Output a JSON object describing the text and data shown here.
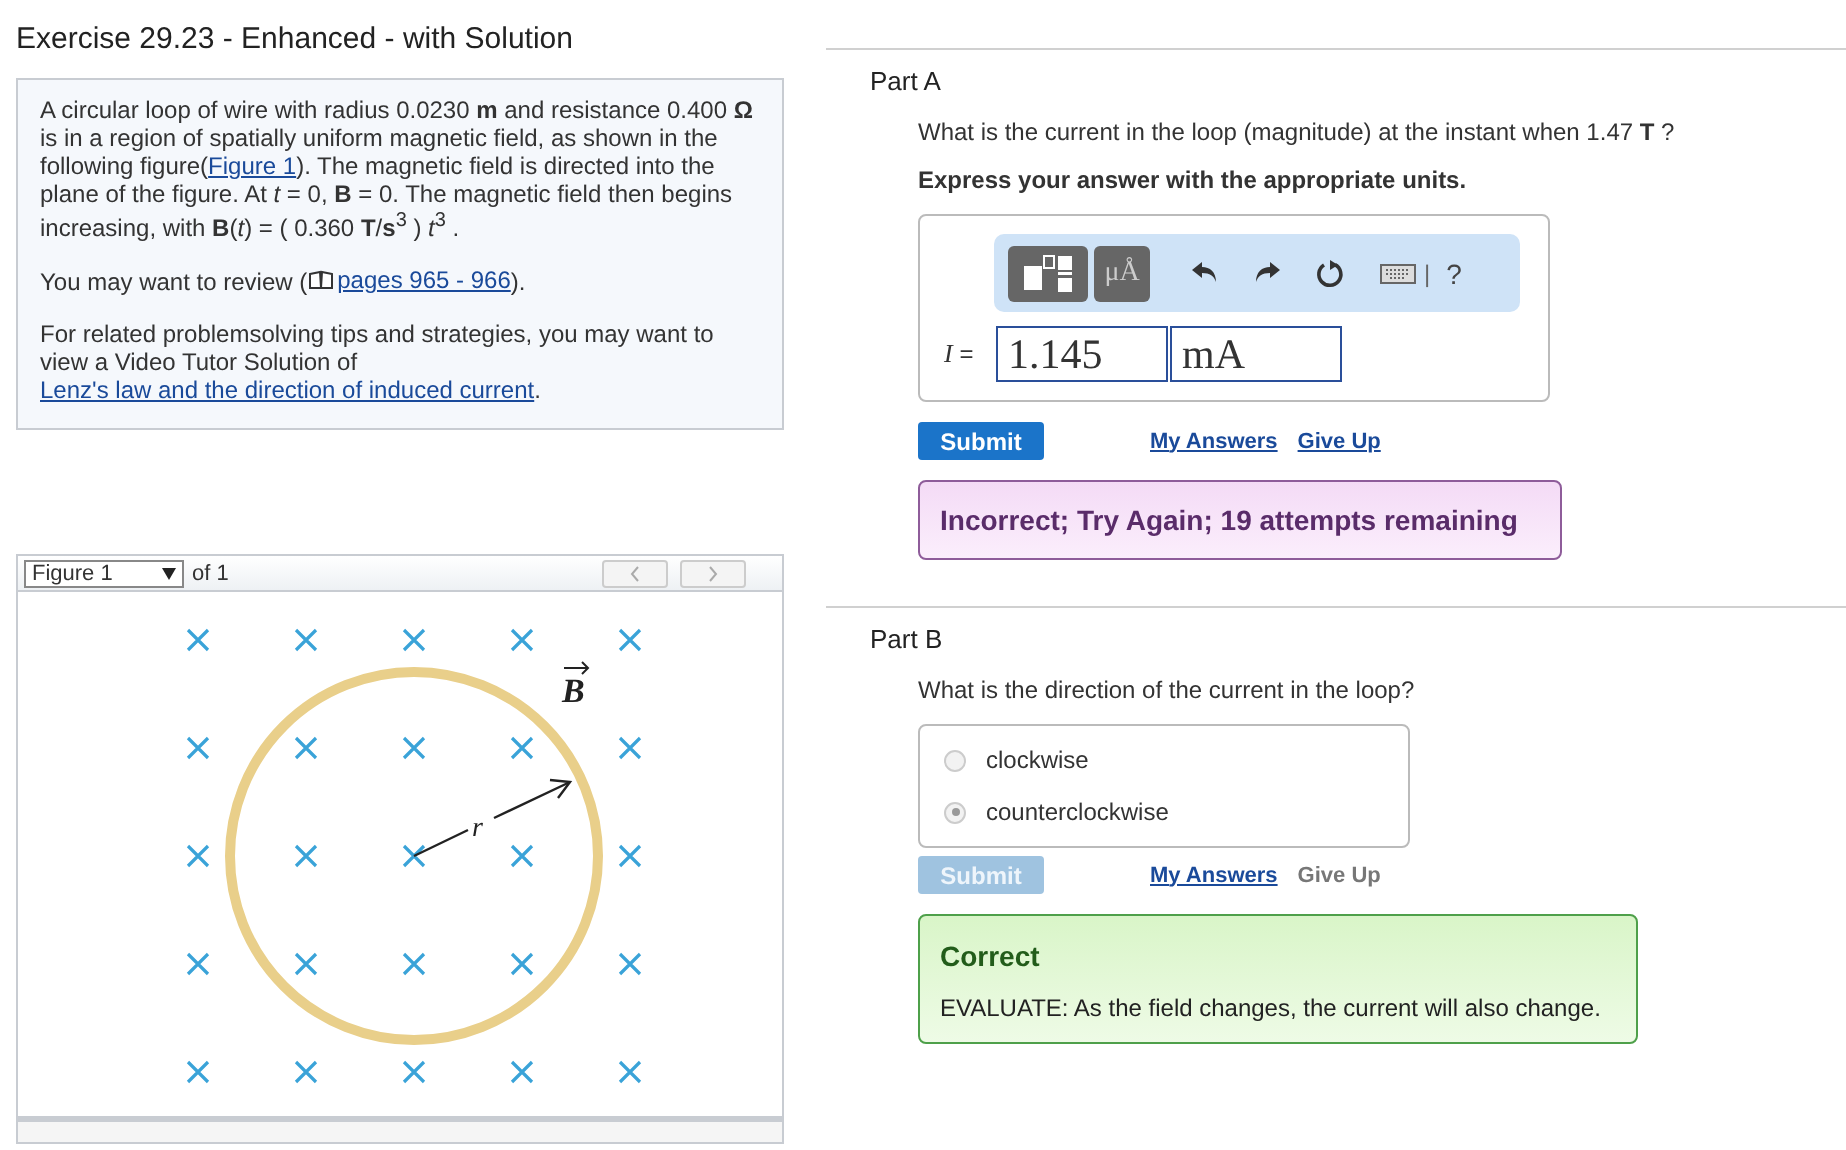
{
  "title": "Exercise 29.23 - Enhanced - with Solution",
  "problem": {
    "paragraphs": [
      {
        "segments": [
          {
            "kind": "text",
            "text": "A circular loop of wire with radius 0.0230 **m** and resistance 0.400 **Ω** is in a region of spatially uniform magnetic field, as shown in the following figure("
          },
          {
            "kind": "link",
            "text": "Figure 1"
          },
          {
            "kind": "text",
            "text": "). The magnetic field is directed into the plane of the figure. At *t* = 0, **B** = 0. The magnetic field then begins increasing, with **B**(*t*) = ( 0.360 **T**/**s**$^{3}$ ) *t*$^{3}$ ."
          }
        ]
      },
      {
        "segments": [
          {
            "kind": "text",
            "text": "You may want to review ("
          },
          {
            "kind": "book-link",
            "text": "pages 965 - 966"
          },
          {
            "kind": "text",
            "text": ")."
          }
        ]
      },
      {
        "segments": [
          {
            "kind": "text",
            "text": "For related problemsolving tips and strategies, you may want to view a Video Tutor Solution of "
          },
          {
            "kind": "link",
            "text": "Lenz's law and the direction of induced current"
          },
          {
            "kind": "text",
            "text": "."
          }
        ]
      }
    ]
  },
  "figure": {
    "selector": "Figure 1",
    "count": "of 1",
    "radius_label": "r",
    "field_label": "B"
  },
  "part_a": {
    "title": "Part A",
    "question": "What is the current in the loop (magnitude) at the instant when 1.47 **T** ?",
    "instruction": "Express your answer with the appropriate units.",
    "toolbar": {
      "units": "μÅ",
      "separator": "|",
      "help": "?"
    },
    "variable": "I",
    "equals": "=",
    "value": "1.145",
    "units": "mA",
    "submit": {
      "label": "Submit",
      "disabled": false
    },
    "my_answers": "My Answers",
    "give_up": {
      "label": "Give Up",
      "disabled": false
    },
    "feedback": {
      "kind": "incorrect",
      "title": "Incorrect; Try Again; 19 attempts remaining"
    }
  },
  "part_b": {
    "title": "Part B",
    "question": "What is the direction of the current in the loop?",
    "options": [
      {
        "label": "clockwise",
        "selected": false
      },
      {
        "label": "counterclockwise",
        "selected": true
      }
    ],
    "submit": {
      "label": "Submit",
      "disabled": true
    },
    "my_answers": "My Answers",
    "give_up": {
      "label": "Give Up",
      "disabled": true
    },
    "feedback": {
      "kind": "correct",
      "title": "Correct",
      "text": "EVALUATE: As the field changes, the current will also change."
    }
  }
}
